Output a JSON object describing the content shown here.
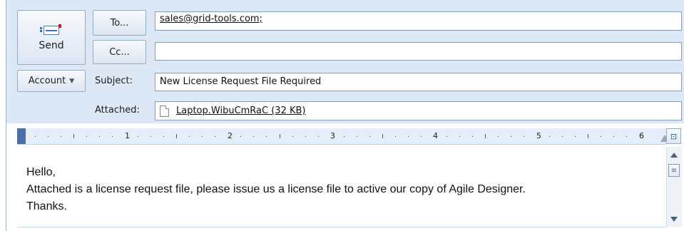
{
  "compose": {
    "send_label": "Send",
    "to_label": "To...",
    "cc_label": "Cc...",
    "account_label": "Account",
    "subject_label": "Subject:",
    "attached_label": "Attached:",
    "to_value": "sales@grid-tools.com;",
    "cc_value": "",
    "subject_value": "New License Request File Required",
    "attachment_name": "Laptop.WibuCmRaC (32 KB)"
  },
  "ruler": {
    "numbers": [
      "1",
      "2",
      "3",
      "4",
      "5",
      "6"
    ]
  },
  "body": {
    "lines": [
      "Hello,",
      "Attached is a license request file, please issue us a license file to active our copy of Agile Designer.",
      "Thanks."
    ]
  },
  "icons": {
    "send": "send-mail-icon",
    "dropdown": "chevron-down-icon",
    "attachment": "document-icon",
    "view_ruler": "view-ruler-icon",
    "scroll_up": "scroll-up-arrow-icon",
    "scroll_down": "scroll-down-arrow-icon"
  }
}
